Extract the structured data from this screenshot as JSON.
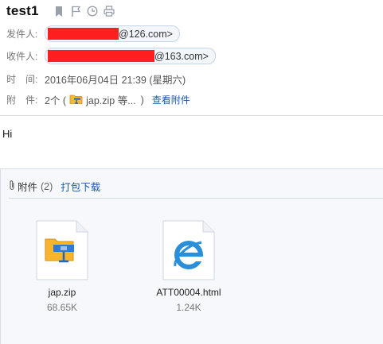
{
  "mail": {
    "subject": "test1",
    "from_label": "发件人:",
    "from_suffix": "@126.com>",
    "to_label": "收件人:",
    "to_suffix": "@163.com>",
    "time_label": "时　间:",
    "time_value": "2016年06月04日 21:39 (星期六)",
    "att_label": "附　件:",
    "att_summary_prefix": "2个 (",
    "att_summary_file": "jap.zip 等...",
    "att_summary_suffix": ")",
    "att_view_link": "查看附件"
  },
  "body_text": "Hi",
  "attachments_panel": {
    "title": "附件",
    "count": "(2)",
    "download_all": "打包下载",
    "files": [
      {
        "name": "jap.zip",
        "size": "68.65K",
        "icon": "zip-archive-icon"
      },
      {
        "name": "ATT00004.html",
        "size": "1.24K",
        "icon": "ie-html-icon"
      }
    ]
  },
  "colors": {
    "link": "#1c5aa6",
    "redaction": "#ff1f1f",
    "pill_border": "#c7d3e6"
  }
}
